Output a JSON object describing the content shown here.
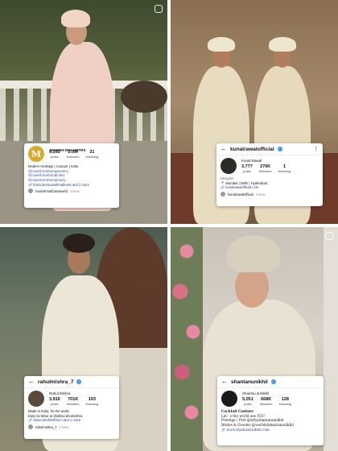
{
  "panels": [
    {
      "handle": "manishmalhotraworld",
      "verified": false,
      "stats": [
        {
          "num": "9,262",
          "label": "posts"
        },
        {
          "num": "2.5M",
          "label": "followers"
        },
        {
          "num": "31",
          "label": "following"
        }
      ],
      "bio": {
        "name": "MANISH MALHOTRA",
        "line1": "Modern Heritage | Couture | India",
        "tags": [
          "@manishmalhotrajewellery",
          "@manishmalhotrabrides",
          "@manishmalhotrabeauty"
        ],
        "link": "linkin.bio/manishmalhotra and 2 more"
      },
      "footer": {
        "handle": "manishmalhotraworld",
        "more": "3 New"
      }
    },
    {
      "handle": "kunalrawalofficial",
      "verified": true,
      "name": "Kunal Rawal",
      "stats": [
        {
          "num": "3,777",
          "label": "posts"
        },
        {
          "num": "276K",
          "label": "followers"
        },
        {
          "num": "1",
          "label": "following"
        }
      ],
      "bio": {
        "category": "Designer",
        "line1": "Mumbai | Delhi | Hyderabad",
        "link": "kunalrawalofficial.com"
      },
      "footer": {
        "handle": "kunalrawalofficial",
        "more": "3 New"
      }
    },
    {
      "handle": "rahulmishra_7",
      "verified": true,
      "name": "Rahul Mishra",
      "stats": [
        {
          "num": "3,916",
          "label": "posts"
        },
        {
          "num": "701K",
          "label": "followers"
        },
        {
          "num": "193",
          "label": "following"
        }
      ],
      "bio": {
        "line1": "Made in India, for the world.",
        "line2": "Easy-to-Wear at @afew.rahulmishra",
        "link": "www.rahulmishra.in and 1 more"
      },
      "footer": {
        "handle": "rahulmishra_7",
        "more": "2 New"
      }
    },
    {
      "handle": "shantanunikhil",
      "verified": true,
      "name": "Shantnu & Nikhil",
      "stats": [
        {
          "num": "5,051",
          "label": "posts"
        },
        {
          "num": "668K",
          "label": "followers"
        },
        {
          "num": "128",
          "label": "following"
        }
      ],
      "bio": {
        "line1": "Cocktail Couture",
        "line2": "Let ' s the world see YOU",
        "line3": "Prestige / Pret @brbyshantanunikhil",
        "line4": "Brides & Grooms @worldofshantanunikhil",
        "link": "www.shantanunikhil.com"
      },
      "footer": {
        "handle": "",
        "more": ""
      }
    }
  ],
  "icons": {
    "back": "back-arrow-icon",
    "more": "more-dots-icon",
    "verified": "verified-badge-icon"
  },
  "colors": {
    "link": "#28427b",
    "verified": "#3897f0",
    "manish_logo": "#d7a92c"
  }
}
